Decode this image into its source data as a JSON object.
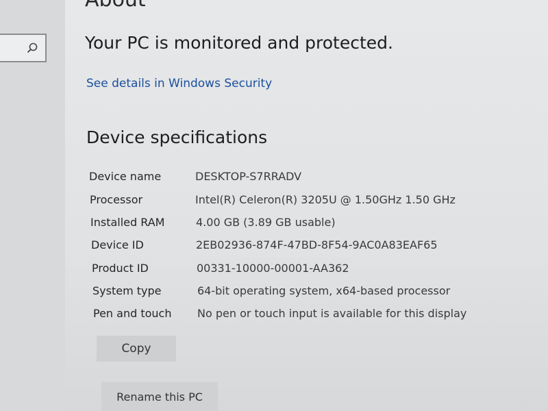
{
  "search": {
    "placeholder": ""
  },
  "header": {
    "title": "About"
  },
  "security": {
    "status": "Your PC is monitored and protected.",
    "link_label": "See details in Windows Security"
  },
  "device_specs": {
    "title": "Device specifications",
    "rows": [
      {
        "label": "Device name",
        "value": "DESKTOP-S7RRADV"
      },
      {
        "label": "Processor",
        "value": "Intel(R) Celeron(R) 3205U @ 1.50GHz   1.50 GHz"
      },
      {
        "label": "Installed RAM",
        "value": "4.00 GB (3.89 GB usable)"
      },
      {
        "label": "Device ID",
        "value": "2EB02936-874F-47BD-8F54-9AC0A83EAF65"
      },
      {
        "label": "Product ID",
        "value": "00331-10000-00001-AA362"
      },
      {
        "label": "System type",
        "value": "64-bit operating system, x64-based processor"
      },
      {
        "label": "Pen and touch",
        "value": "No pen or touch input is available for this display"
      }
    ],
    "copy_label": "Copy",
    "rename_label": "Rename this PC"
  }
}
